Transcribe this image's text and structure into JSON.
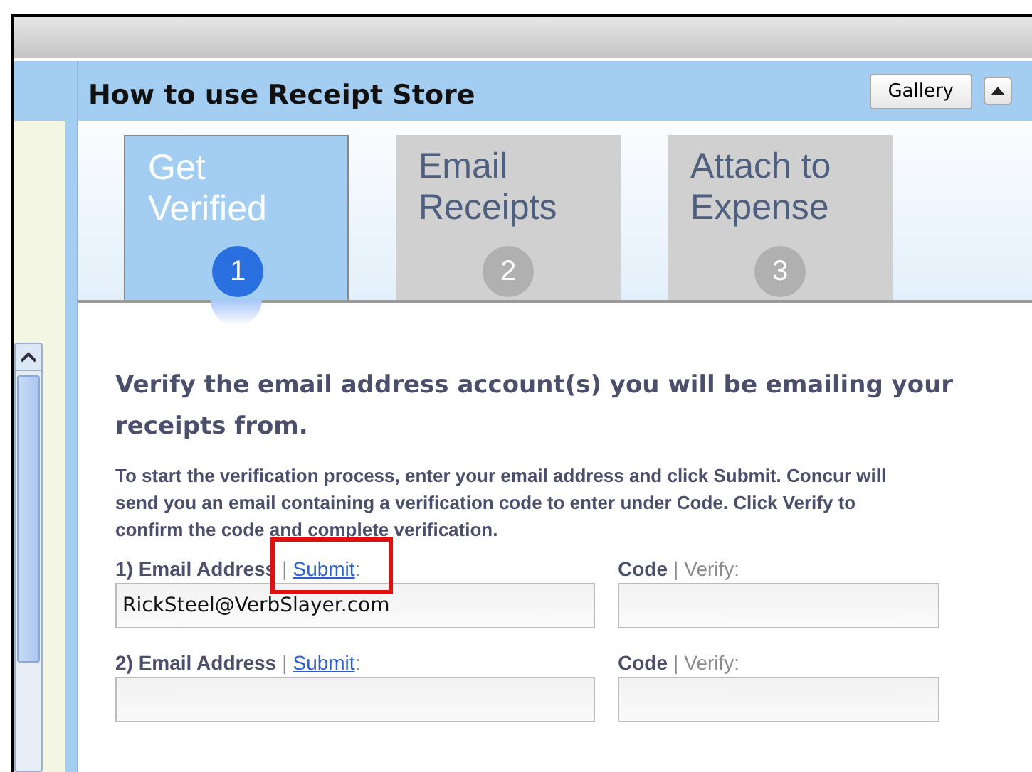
{
  "panel": {
    "title": "How to use Receipt Store",
    "gallery_button": "Gallery"
  },
  "steps": [
    {
      "label": "Get Verified",
      "number": "1",
      "selected": true
    },
    {
      "label": "Email Receipts",
      "number": "2",
      "selected": false
    },
    {
      "label": "Attach to Expense",
      "number": "3",
      "selected": false
    }
  ],
  "heading": "Verify the email address account(s) you will be emailing your receipts from.",
  "instructions": "To start the verification process, enter your email address and click Submit. Concur will send you an email containing a verification code to enter under Code. Click Verify to confirm the code and complete verification.",
  "rows": [
    {
      "email_label": "1) Email Address",
      "separator": "|",
      "submit_link": "Submit",
      "colon": ":",
      "email_value": "RickSteel@VerbSlayer.com",
      "code_label": "Code",
      "code_separator": "|",
      "verify_label": "Verify:",
      "highlighted": true
    },
    {
      "email_label": "2) Email Address",
      "separator": "|",
      "submit_link": "Submit",
      "colon": ":",
      "email_value": "",
      "code_label": "Code",
      "code_separator": "|",
      "verify_label": "Verify:",
      "highlighted": false
    }
  ]
}
